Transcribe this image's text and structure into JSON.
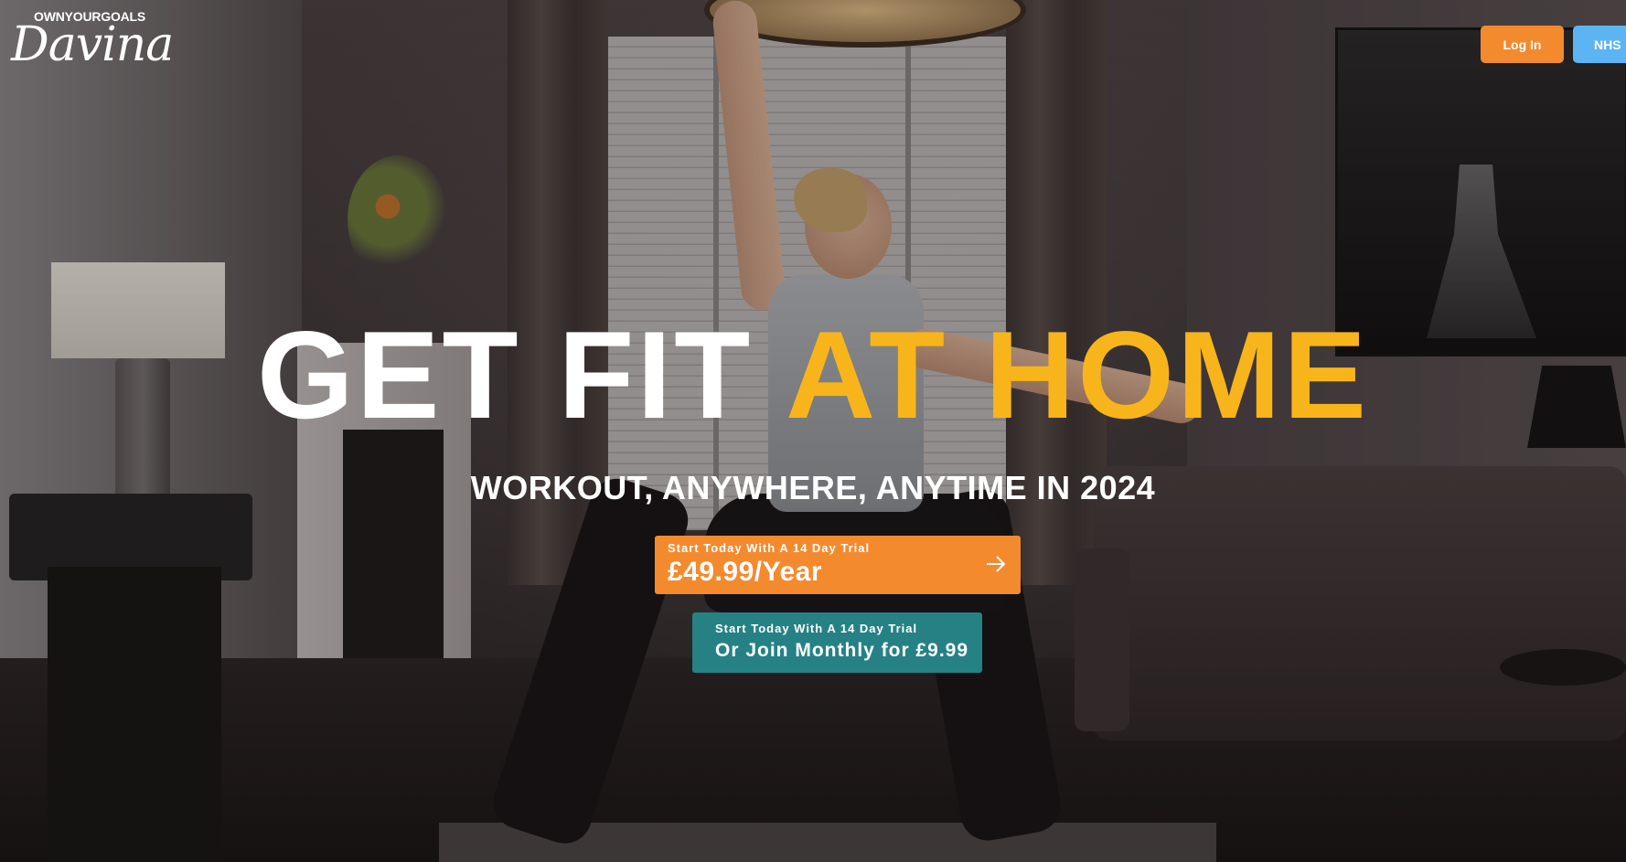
{
  "logo": {
    "brand_top": "OWNYOURGOALS",
    "brand_script": "Davina"
  },
  "nav": {
    "login_label": "Log In",
    "nhs_label": "NHS"
  },
  "hero": {
    "headline_white": "GET FIT",
    "headline_yellow": "AT HOME",
    "subheadline": "WORKOUT, ANYWHERE, ANYTIME IN 2024"
  },
  "cta_yearly": {
    "small_label": "Start Today With A 14 Day Trial",
    "price_label": "£49.99/Year",
    "icon": "arrow-right-icon"
  },
  "cta_monthly": {
    "small_label": "Start Today With A 14 Day Trial",
    "price_label": "Or Join Monthly for £9.99"
  },
  "colors": {
    "accent_orange": "#f48a2e",
    "headline_yellow": "#f8b51b",
    "teal": "#268185",
    "nhs_blue": "#5db4f3"
  }
}
